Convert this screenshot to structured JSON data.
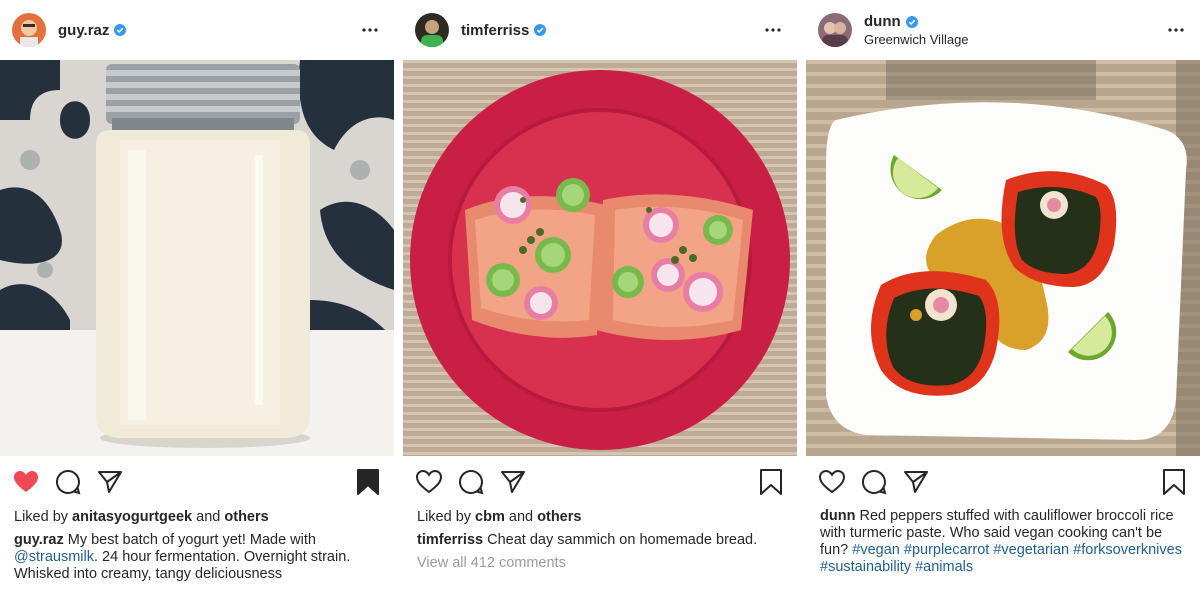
{
  "posts": [
    {
      "username": "guy.raz",
      "location": "",
      "liked_by_prefix": "Liked by",
      "liked_by_user": "anitasyogurtgeek",
      "liked_by_and": "and",
      "liked_by_others": "others",
      "caption_user": "guy.raz",
      "caption_part1": "My best batch of yogurt yet! Made with",
      "caption_mention": "@strausmilk",
      "caption_part2": ". 24 hour fermentation. Overnight strain. Whisked into creamy, tangy deliciousness",
      "liked": true,
      "saved": true
    },
    {
      "username": "timferriss",
      "location": "",
      "liked_by_prefix": "Liked by",
      "liked_by_user": "cbm",
      "liked_by_and": "and",
      "liked_by_others": "others",
      "caption_user": "timferriss",
      "caption_text": "Cheat day sammich on homemade bread.",
      "view_comments": "View all 412 comments",
      "liked": false,
      "saved": false
    },
    {
      "username": "dunn",
      "location": "Greenwich Village",
      "caption_user": "dunn",
      "caption_text": "Red peppers stuffed with cauliflower broccoli rice with turmeric paste. Who said vegan cooking can't be fun?",
      "hashtags": [
        "#vegan",
        "#purplecarrot",
        "#vegetarian",
        "#forksoverknives",
        "#sustainability",
        "#animals"
      ],
      "liked": false,
      "saved": false
    }
  ],
  "icons": {
    "like": "heart-icon",
    "comment": "comment-icon",
    "share": "paper-plane-icon",
    "save": "bookmark-icon",
    "more": "ellipsis-icon",
    "verified": "verified-badge-icon"
  },
  "colors": {
    "like_red": "#ed4956",
    "verified_blue": "#3897f0",
    "link_blue": "#1f5e91",
    "muted_gray": "#9a9a9a",
    "text": "#262626"
  }
}
